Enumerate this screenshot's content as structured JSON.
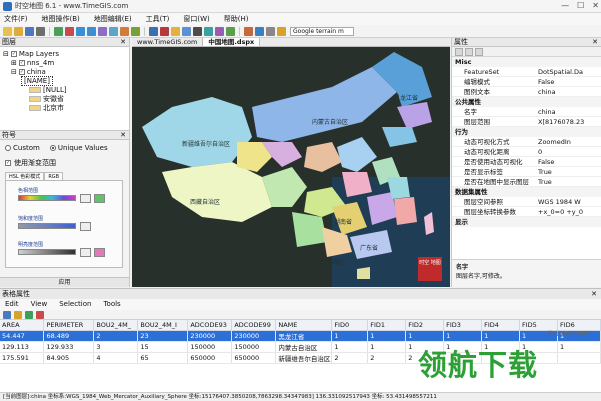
{
  "window": {
    "title": "时空地图 6.1 - www.TimeGIS.com",
    "minimize": "—",
    "maximize": "☐",
    "close": "✕"
  },
  "menubar": [
    "文件(F)",
    "地图操作(B)",
    "地图编辑(E)",
    "工具(T)",
    "窗口(W)",
    "帮助(H)"
  ],
  "toolbar": {
    "basemap_select": "Google terrain m"
  },
  "layers_panel": {
    "title": "图层",
    "close": "✕",
    "tree": [
      {
        "label": "Map Layers",
        "indent": 0
      },
      {
        "label": "nns_4m",
        "indent": 1
      },
      {
        "label": "china",
        "indent": 1
      },
      {
        "label": "[NAME]",
        "indent": 2,
        "selected": true
      },
      {
        "label": "[NULL]",
        "indent": 3,
        "swatch": "#f2d38a"
      },
      {
        "label": "安徽省",
        "indent": 3,
        "swatch": "#f2d38a"
      },
      {
        "label": "北京市",
        "indent": 3,
        "swatch": "#f2d38a"
      }
    ]
  },
  "symbology_panel": {
    "title": "符号",
    "close": "✕",
    "radio_custom": "Custom",
    "radio_unique": "Unique Values",
    "use_gradient": "使用渐变范围",
    "tab_hsl": "HSL 色彩模式",
    "tab_rgb": "RGB",
    "ramp_start": "色相范围",
    "ramp_saturation": "饱和度范围",
    "ramp_lightness": "明亮度范围",
    "apply": "应用"
  },
  "document_tabs": [
    "www.TimeGIS.com",
    "中国地图.dspx"
  ],
  "map": {
    "labels": [
      "新疆维吾尔自治区",
      "西藏自治区",
      "内蒙古自治区",
      "黑龙江省",
      "湖南省",
      "广东省",
      "广西壮族自治区"
    ],
    "seal_text": "时空 地图"
  },
  "properties_panel": {
    "title": "属性",
    "close": "✕",
    "rows": [
      {
        "type": "category",
        "key": "Misc"
      },
      {
        "key": "FeatureSet",
        "value": "DotSpatial.Da"
      },
      {
        "key": "编辑模式",
        "value": "False"
      },
      {
        "key": "图例文本",
        "value": "china"
      },
      {
        "type": "category",
        "key": "公共属性"
      },
      {
        "key": "名字",
        "value": "china"
      },
      {
        "key": "图层范围",
        "value": "X[8176078.23"
      },
      {
        "type": "category",
        "key": "行为"
      },
      {
        "key": "动态可视化方式",
        "value": "ZoomedIn"
      },
      {
        "key": "动态可视化距离",
        "value": "0"
      },
      {
        "key": "是否使用动态可视化",
        "value": "False"
      },
      {
        "key": "是否显示标签",
        "value": "True"
      },
      {
        "key": "是否在地图中显示图层",
        "value": "True"
      },
      {
        "type": "category",
        "key": "数据集属性"
      },
      {
        "key": "图层空间参照",
        "value": "WGS 1984 W"
      },
      {
        "key": "图层坐标转换参数",
        "value": "+x_0=0 +y_0"
      },
      {
        "type": "category",
        "key": "显示"
      }
    ],
    "desc_title": "名字",
    "desc_text": "图层名字,可修改。"
  },
  "attribute_table": {
    "title": "表格属性",
    "close": "✕",
    "menu": [
      "Edit",
      "View",
      "Selection",
      "Tools"
    ],
    "columns": [
      "AREA",
      "PERIMETER",
      "BOU2_4M_",
      "BOU2_4M_I",
      "ADCODE93",
      "ADCODE99",
      "NAME",
      "FID0",
      "FID1",
      "FID2",
      "FID3",
      "FID4",
      "FID5",
      "FID6"
    ],
    "rows": [
      [
        "54.447",
        "68.489",
        "2",
        "23",
        "230000",
        "230000",
        "黑龙江省",
        "1",
        "1",
        "1",
        "1",
        "1",
        "1",
        "1"
      ],
      [
        "129.113",
        "129.933",
        "3",
        "15",
        "150000",
        "150000",
        "内蒙古自治区",
        "1",
        "1",
        "1",
        "1",
        "1",
        "1",
        "1"
      ],
      [
        "175.591",
        "84.905",
        "4",
        "65",
        "650000",
        "650000",
        "新疆维吾尔自治区",
        "2",
        "2",
        "2",
        "",
        "",
        "",
        ""
      ]
    ]
  },
  "statusbar": "[当前图层]:china 坐标系:WGS_1984_Web_Mercator_Auxiliary_Sphere 坐标:15176407.3850208,7863298.34347983] 136.331092517943 坐标: 53.431498557211",
  "watermark": {
    "text": "领航下载",
    "sub": "lhdown.com"
  },
  "colors": {
    "selection": "#2c6fd6",
    "map_background": "#262f27",
    "accent": "#2f6ebd"
  }
}
